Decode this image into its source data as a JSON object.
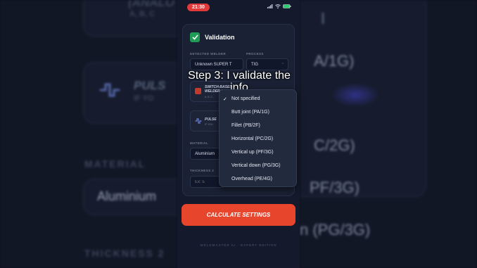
{
  "status_bar": {
    "time": "21:30"
  },
  "caption": "Step 3: I validate the info",
  "card": {
    "title": "Validation",
    "detected_welder_label": "DETECTED WELDER",
    "detected_welder_value": "Unknown SUPER T",
    "process_label": "PROCESS",
    "process_value": "TIG",
    "option1_title": "SWITCH-BASED WELDER (ANALOG)",
    "option1_sub": "A, B, C...",
    "option2_title": "PULSE",
    "option2_sub": "IF YOU",
    "material_label": "MATERIAL",
    "material_value": "Aluminium",
    "thickness_label": "THICKNESS 2",
    "thickness_placeholder": "Ex: 5"
  },
  "position_dropdown": {
    "selected_index": 0,
    "options": [
      "Not specified",
      "Butt joint (PA/1G)",
      "Fillet (PB/2F)",
      "Horizontal (PC/2G)",
      "Vertical up (PF/3G)",
      "Vertical down (PG/3G)",
      "Overhead (PE/4G)"
    ]
  },
  "calculate_button": "CALCULATE SETTINGS",
  "footer": "WELDMASTER AI · EXPERT EDITION",
  "background": {
    "left_top": "(ANALO",
    "left_sub": "A, B, C",
    "left_pulse": "PULS",
    "left_pulse_sub": "IF YO",
    "left_material_label": "MATERIAL",
    "left_material_value": "Aluminium",
    "left_thickness_label": "THICKNESS 2",
    "right_1": "A/1G)",
    "right_2": "C/2G)",
    "right_3": "PF/3G)",
    "right_4": "n (PG/3G)"
  },
  "colors": {
    "accent": "#e8452d",
    "check": "#1f9d55",
    "status": "#e23a3a"
  }
}
